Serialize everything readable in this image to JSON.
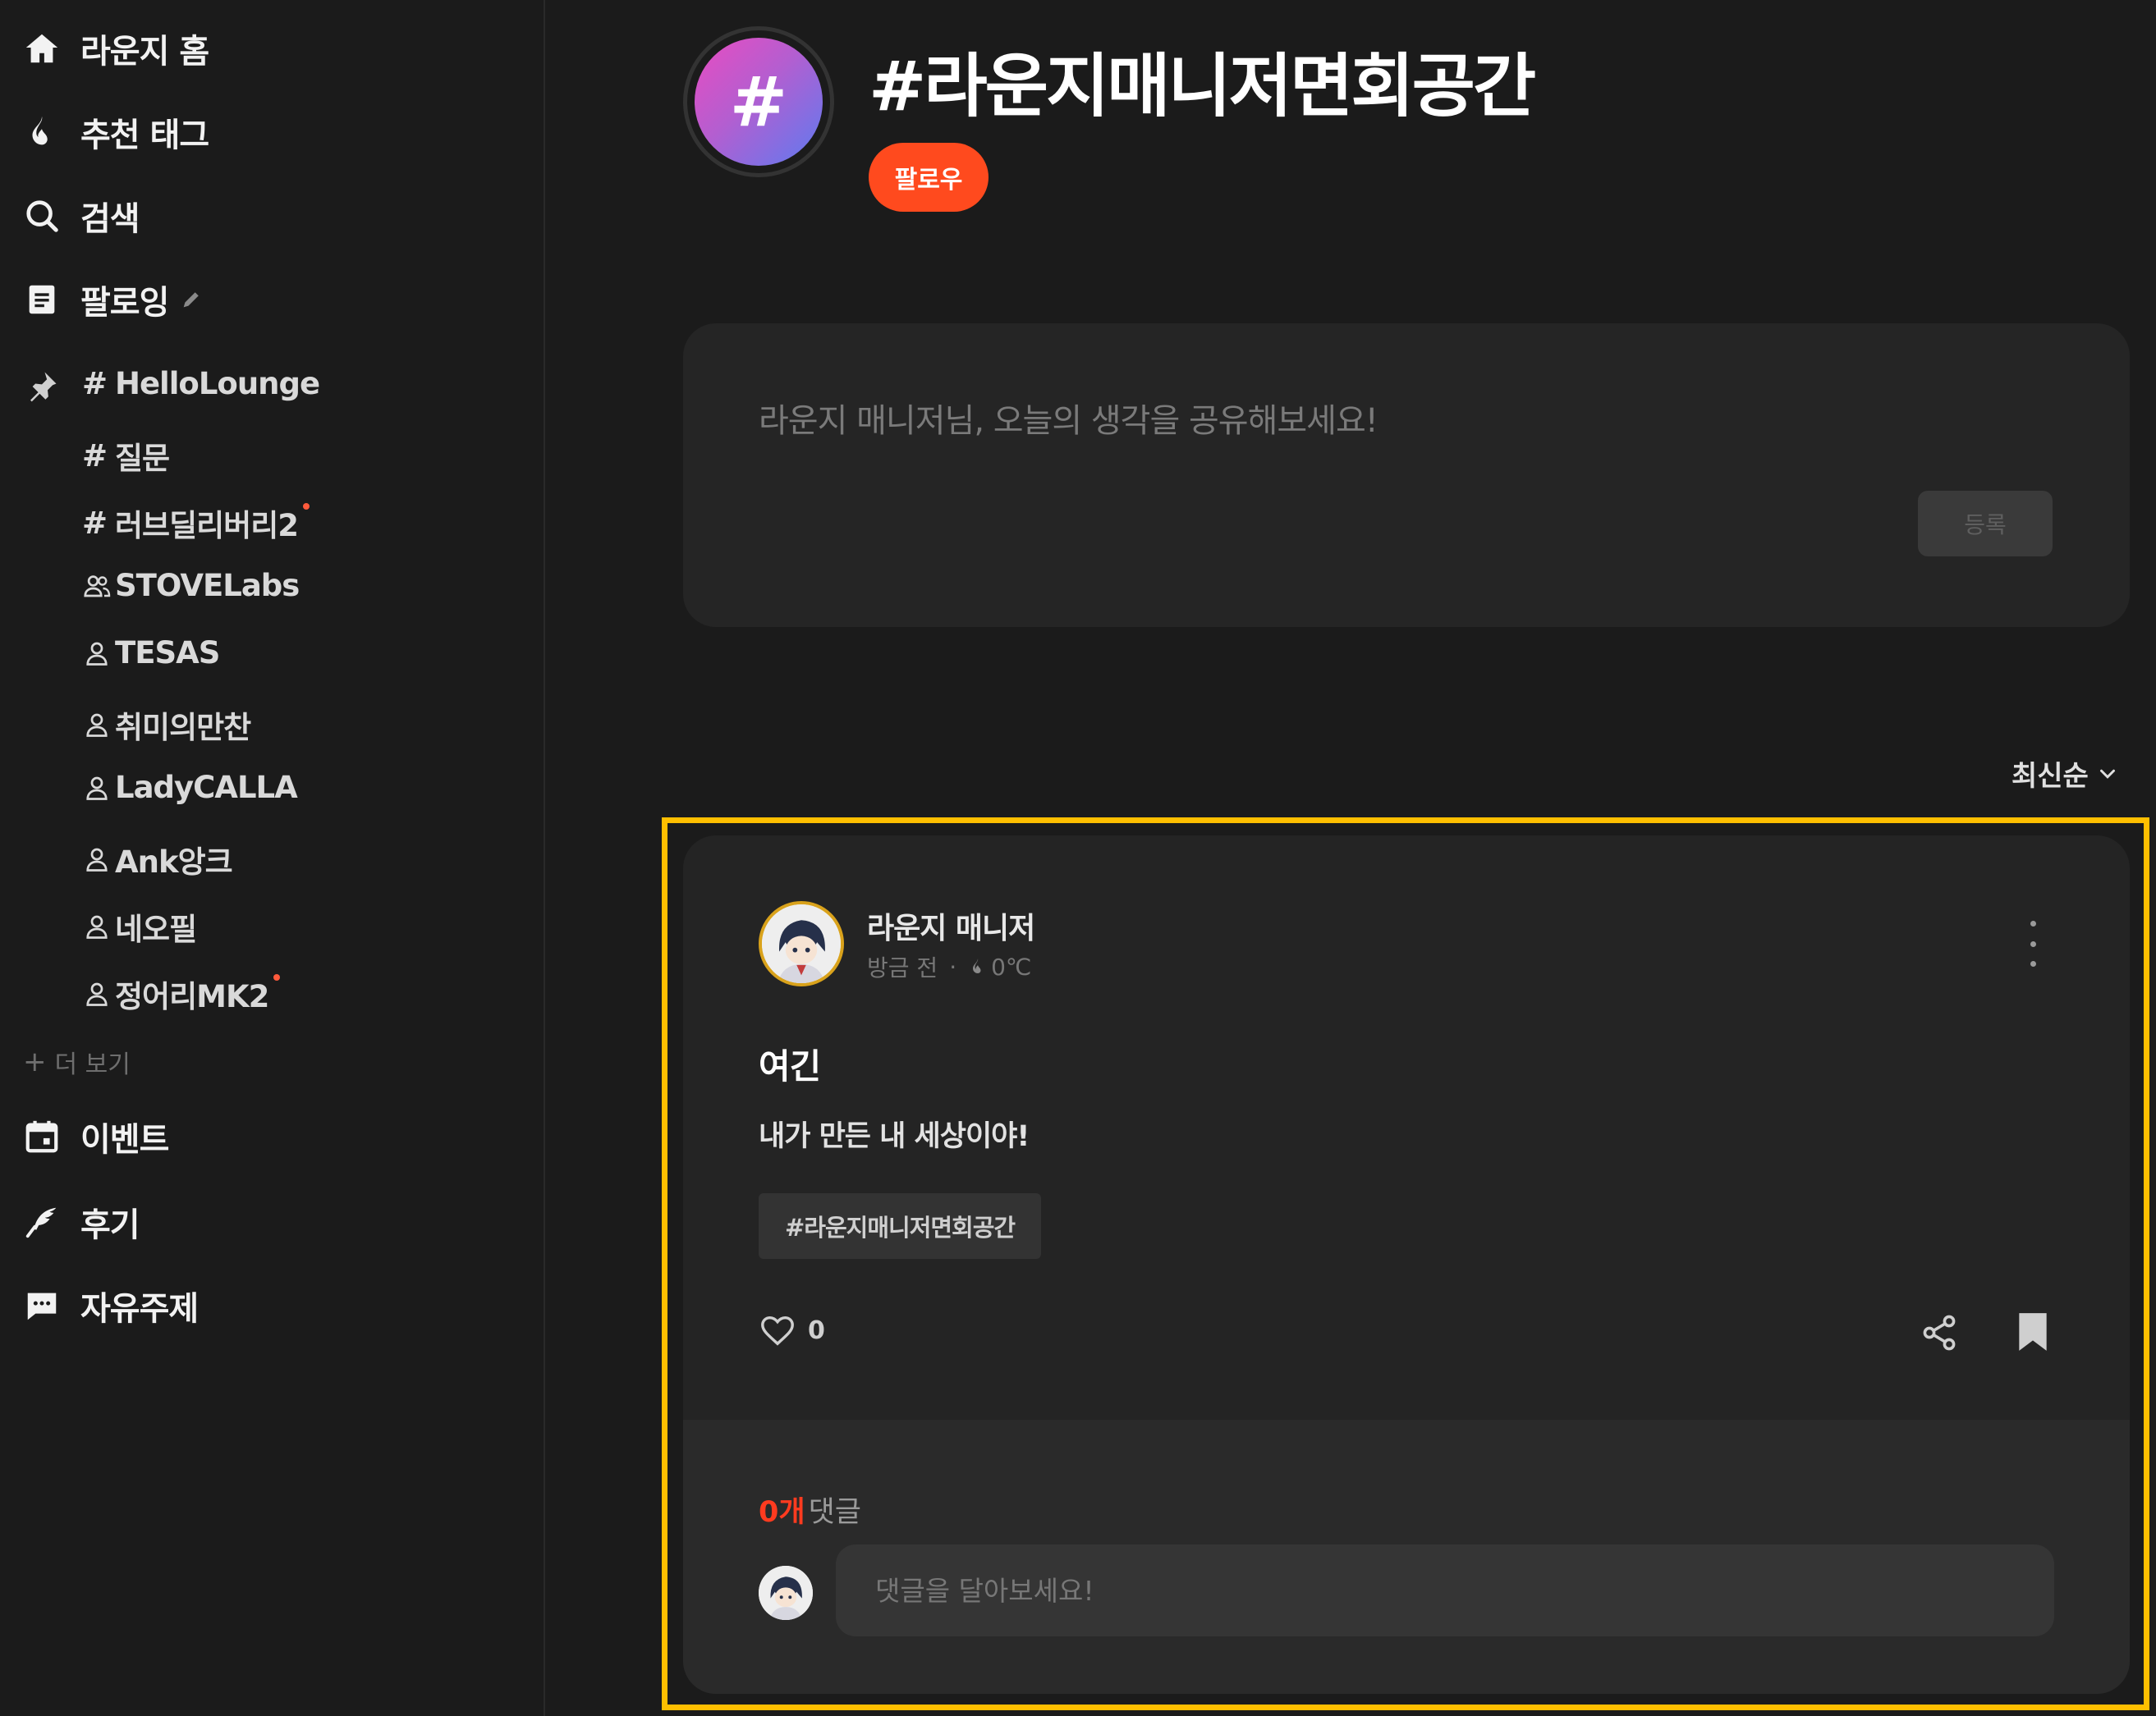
{
  "sidebar": {
    "main_items": [
      {
        "label": "라운지 홈",
        "icon": "home-icon"
      },
      {
        "label": "추천 태그",
        "icon": "fire-icon"
      },
      {
        "label": "검색",
        "icon": "search-icon"
      },
      {
        "label": "팔로잉",
        "icon": "document-icon"
      }
    ],
    "following": [
      {
        "prefix": "#",
        "label": "HelloLounge",
        "pinned": true
      },
      {
        "prefix": "#",
        "label": "질문"
      },
      {
        "prefix": "#",
        "label": "러브딜리버리2",
        "new": true
      },
      {
        "prefix": "group",
        "label": "STOVELabs"
      },
      {
        "prefix": "user",
        "label": "TESAS"
      },
      {
        "prefix": "user",
        "label": "취미의만찬"
      },
      {
        "prefix": "user",
        "label": "LadyCALLA"
      },
      {
        "prefix": "user",
        "label": "Ank앙크"
      },
      {
        "prefix": "user",
        "label": "네오필"
      },
      {
        "prefix": "user",
        "label": "정어리MK2",
        "new": true
      }
    ],
    "more_label": "더 보기",
    "bottom_items": [
      {
        "label": "이벤트",
        "icon": "calendar-icon"
      },
      {
        "label": "후기",
        "icon": "quill-icon"
      },
      {
        "label": "자유주제",
        "icon": "chat-icon"
      }
    ]
  },
  "header": {
    "avatar_symbol": "#",
    "title": "#라운지매니저면회공간",
    "follow_label": "팔로우"
  },
  "composer": {
    "placeholder": "라운지 매니저님, 오늘의 생각을 공유해보세요!",
    "submit_label": "등록"
  },
  "sort": {
    "label": "최신순"
  },
  "post": {
    "author": "라운지 매니저",
    "time": "방금 전",
    "temperature": "0℃",
    "title": "여긴",
    "body": "내가 만든 내 세상이야!",
    "tag": "#라운지매니저면회공간",
    "likes": "0",
    "comment_count": "0개",
    "comment_label": "댓글",
    "comment_placeholder": "댓글을 달아보세요!"
  },
  "colors": {
    "accent": "#ff4a1e",
    "highlight": "#ffbf00",
    "background": "#1b1b1b",
    "card": "#242424"
  }
}
